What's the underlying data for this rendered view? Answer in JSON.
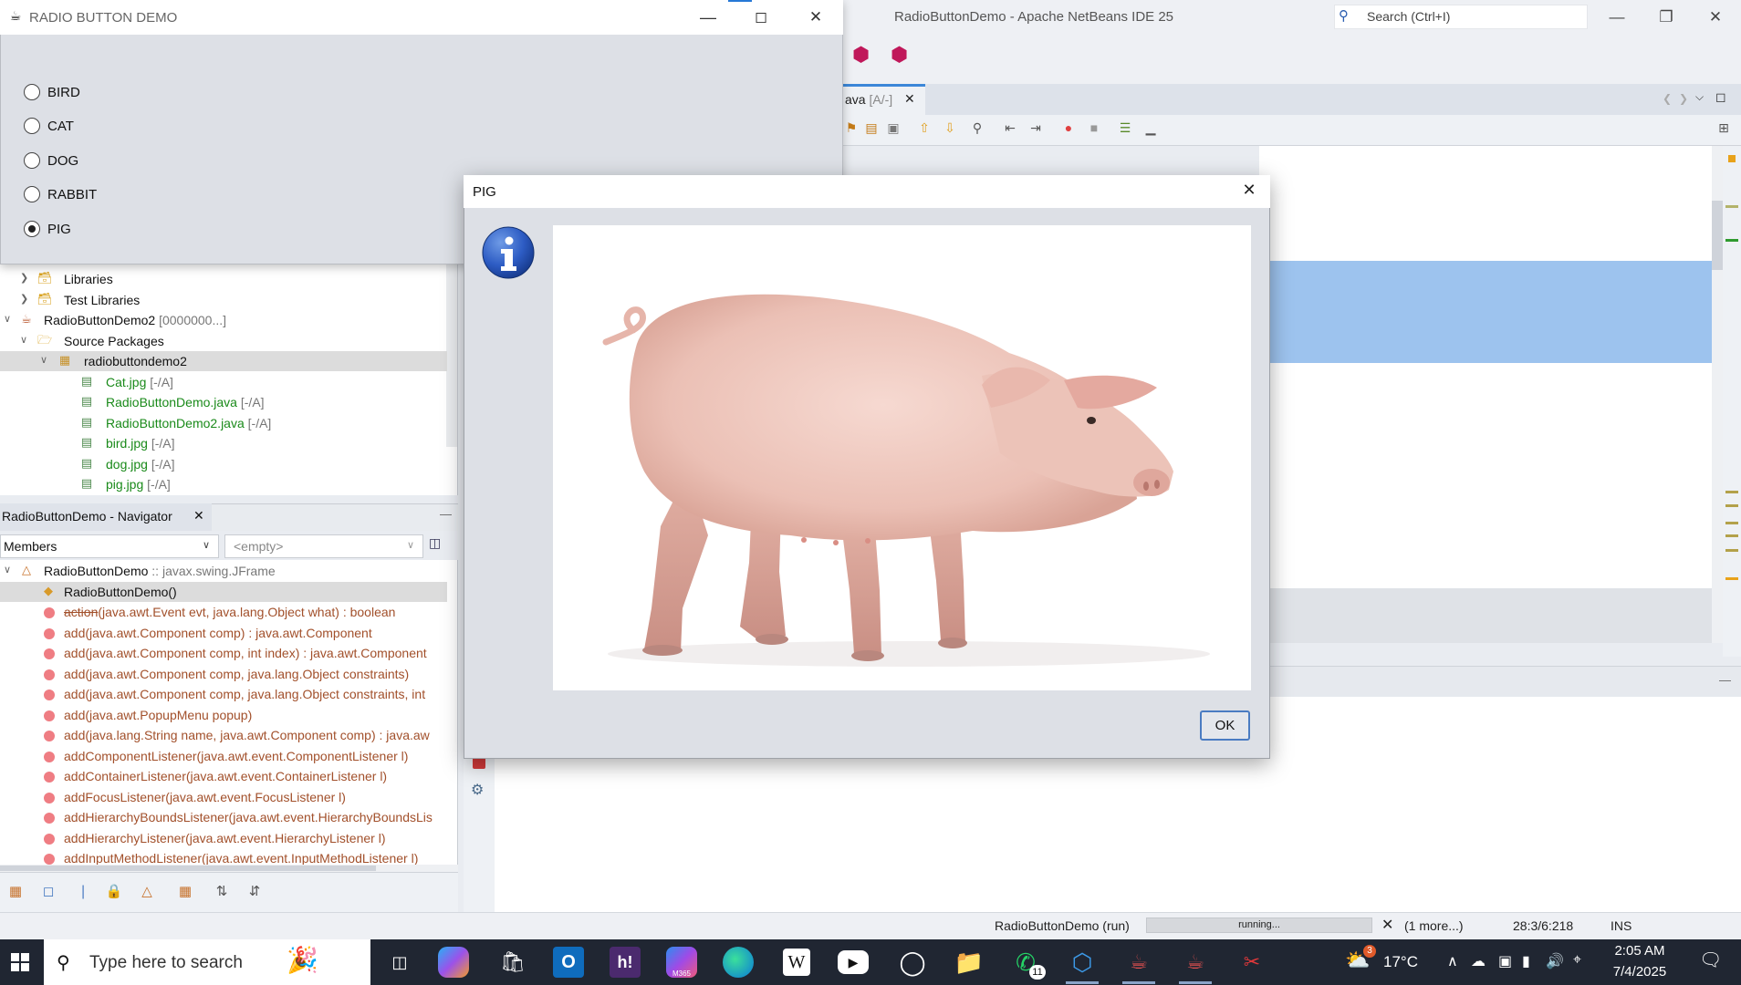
{
  "ide": {
    "title": "RadioButtonDemo - Apache NetBeans IDE 25",
    "search_placeholder": "Search (Ctrl+I)",
    "editor_tab": {
      "label": "ava",
      "status": "[A/-]",
      "close": "✕"
    },
    "status": {
      "run_label": "RadioButtonDemo (run)",
      "progress_text": "running...",
      "more": "(1 more...)",
      "position": "28:3/6:218",
      "mode": "INS"
    }
  },
  "projects_tree": {
    "rows": [
      {
        "label": "Libraries",
        "meta": ""
      },
      {
        "label": "Test Libraries",
        "meta": ""
      },
      {
        "label": "RadioButtonDemo2",
        "meta": "[0000000...]"
      },
      {
        "label": "Source Packages",
        "meta": ""
      },
      {
        "label": "radiobuttondemo2",
        "meta": ""
      },
      {
        "label": "Cat.jpg",
        "meta": "[-/A]"
      },
      {
        "label": "RadioButtonDemo.java",
        "meta": "[-/A]"
      },
      {
        "label": "RadioButtonDemo2.java",
        "meta": "[-/A]"
      },
      {
        "label": "bird.jpg",
        "meta": "[-/A]"
      },
      {
        "label": "dog.jpg",
        "meta": "[-/A]"
      },
      {
        "label": "pig.jpg",
        "meta": "[-/A]"
      }
    ]
  },
  "navigator": {
    "title": "RadioButtonDemo - Navigator",
    "close": "✕",
    "members_label": "Members",
    "empty_label": "<empty>",
    "class_name": "RadioButtonDemo",
    "class_type": ":: javax.swing.JFrame",
    "constructor": "RadioButtonDemo()",
    "methods": [
      {
        "name": "action",
        "rest": "(java.awt.Event evt, java.lang.Object what) : boolean"
      },
      {
        "name": "add(java.awt.Component comp) : java.awt.Component",
        "rest": ""
      },
      {
        "name": "add(java.awt.Component comp, int index) : java.awt.Component",
        "rest": ""
      },
      {
        "name": "add(java.awt.Component comp, java.lang.Object constraints)",
        "rest": ""
      },
      {
        "name": "add(java.awt.Component comp, java.lang.Object constraints, int",
        "rest": ""
      },
      {
        "name": "add(java.awt.PopupMenu popup)",
        "rest": ""
      },
      {
        "name": "add(java.lang.String name, java.awt.Component comp) : java.aw",
        "rest": ""
      },
      {
        "name": "addComponentListener(java.awt.event.ComponentListener l)",
        "rest": ""
      },
      {
        "name": "addContainerListener(java.awt.event.ContainerListener l)",
        "rest": ""
      },
      {
        "name": "addFocusListener(java.awt.event.FocusListener l)",
        "rest": ""
      },
      {
        "name": "addHierarchyBoundsListener(java.awt.event.HierarchyBoundsLis",
        "rest": ""
      },
      {
        "name": "addHierarchyListener(java.awt.event.HierarchyListener l)",
        "rest": ""
      },
      {
        "name": "addInputMethodListener(java.awt.event.InputMethodListener l)",
        "rest": ""
      }
    ]
  },
  "demo_window": {
    "title": "RADIO BUTTON DEMO",
    "options": [
      {
        "label": "BIRD",
        "selected": false
      },
      {
        "label": "CAT",
        "selected": false
      },
      {
        "label": "DOG",
        "selected": false
      },
      {
        "label": "RABBIT",
        "selected": false
      },
      {
        "label": "PIG",
        "selected": true
      }
    ]
  },
  "dialog": {
    "title": "PIG",
    "icon": "info-icon",
    "ok_label": "OK",
    "image": "pig-photo"
  },
  "taskbar": {
    "search_placeholder": "Type here to search",
    "whatsapp_badge": "11",
    "weather_badge": "3",
    "temperature": "17°C",
    "time": "2:05 AM",
    "date": "7/4/2025",
    "ms365_label": "M365",
    "wiki_label": "W",
    "outlook_label": "O",
    "hi_label": "h!"
  }
}
